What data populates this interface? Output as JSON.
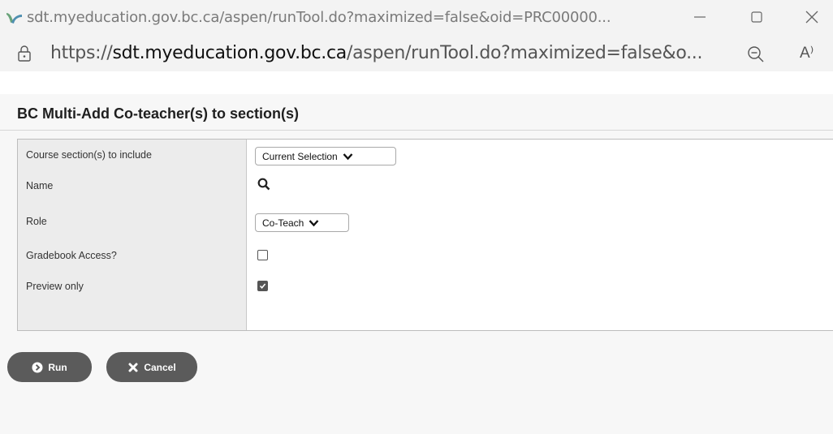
{
  "window": {
    "title": "sdt.myeducation.gov.bc.ca/aspen/runTool.do?maximized=false&oid=PRC00000...",
    "icons": [
      "site-favicon-icon",
      "minimize-icon",
      "maximize-icon",
      "close-icon"
    ]
  },
  "addressbar": {
    "url_proto": "https://",
    "url_host": "sdt.myeducation.gov.bc.ca",
    "url_path": "/aspen/runTool.do?maximized=false&o...",
    "readaloud_label": "A⁾"
  },
  "page": {
    "title": "BC Multi-Add Co-teacher(s) to section(s)"
  },
  "form": {
    "rows": [
      {
        "label": "Course section(s) to include",
        "type": "select",
        "value": "Current Selection"
      },
      {
        "label": "Name",
        "type": "search"
      },
      {
        "label": "Role",
        "type": "select",
        "value": "Co-Teach"
      },
      {
        "label": "Gradebook Access?",
        "type": "checkbox",
        "checked": false
      },
      {
        "label": "Preview only",
        "type": "checkbox",
        "checked": true
      }
    ]
  },
  "buttons": {
    "run_label": "Run",
    "cancel_label": "Cancel"
  },
  "colors": {
    "button_bg": "#5b5b5b",
    "label_column_bg": "#ececec",
    "favicon_green": "#5e9c6f"
  }
}
